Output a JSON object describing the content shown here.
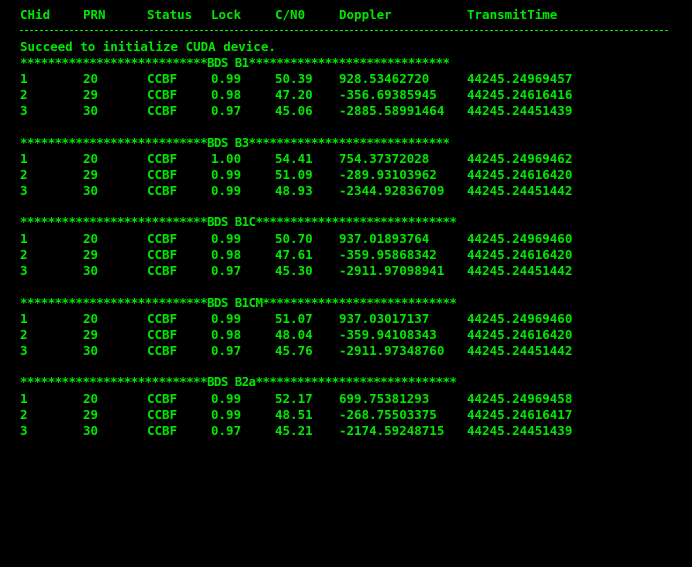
{
  "colors": {
    "background": "#000000",
    "text": "#00e800"
  },
  "header": [
    "CHid",
    "PRN",
    "Status",
    "Lock",
    "C/N0",
    "Doppler",
    "TransmitTime"
  ],
  "message": "Succeed to initialize CUDA device.",
  "blocks": [
    {
      "banner": "***************************BDS B1*****************************",
      "rows": [
        [
          "1",
          "20",
          "CCBF",
          "0.99",
          "50.39",
          "928.53462720",
          "44245.24969457"
        ],
        [
          "2",
          "29",
          "CCBF",
          "0.98",
          "47.20",
          "-356.69385945",
          "44245.24616416"
        ],
        [
          "3",
          "30",
          "CCBF",
          "0.97",
          "45.06",
          "-2885.58991464",
          "44245.24451439"
        ]
      ]
    },
    {
      "banner": "***************************BDS B3*****************************",
      "rows": [
        [
          "1",
          "20",
          "CCBF",
          "1.00",
          "54.41",
          "754.37372028",
          "44245.24969462"
        ],
        [
          "2",
          "29",
          "CCBF",
          "0.99",
          "51.09",
          "-289.93103962",
          "44245.24616420"
        ],
        [
          "3",
          "30",
          "CCBF",
          "0.99",
          "48.93",
          "-2344.92836709",
          "44245.24451442"
        ]
      ]
    },
    {
      "banner": "***************************BDS B1C*****************************",
      "rows": [
        [
          "1",
          "20",
          "CCBF",
          "0.99",
          "50.70",
          "937.01893764",
          "44245.24969460"
        ],
        [
          "2",
          "29",
          "CCBF",
          "0.98",
          "47.61",
          "-359.95868342",
          "44245.24616420"
        ],
        [
          "3",
          "30",
          "CCBF",
          "0.97",
          "45.30",
          "-2911.97098941",
          "44245.24451442"
        ]
      ]
    },
    {
      "banner": "***************************BDS B1CM****************************",
      "rows": [
        [
          "1",
          "20",
          "CCBF",
          "0.99",
          "51.07",
          "937.03017137",
          "44245.24969460"
        ],
        [
          "2",
          "29",
          "CCBF",
          "0.98",
          "48.04",
          "-359.94108343",
          "44245.24616420"
        ],
        [
          "3",
          "30",
          "CCBF",
          "0.97",
          "45.76",
          "-2911.97348760",
          "44245.24451442"
        ]
      ]
    },
    {
      "banner": "***************************BDS B2a*****************************",
      "rows": [
        [
          "1",
          "20",
          "CCBF",
          "0.99",
          "52.17",
          "699.75381293",
          "44245.24969458"
        ],
        [
          "2",
          "29",
          "CCBF",
          "0.99",
          "48.51",
          "-268.75503375",
          "44245.24616417"
        ],
        [
          "3",
          "30",
          "CCBF",
          "0.97",
          "45.21",
          "-2174.59248715",
          "44245.24451439"
        ]
      ]
    }
  ]
}
